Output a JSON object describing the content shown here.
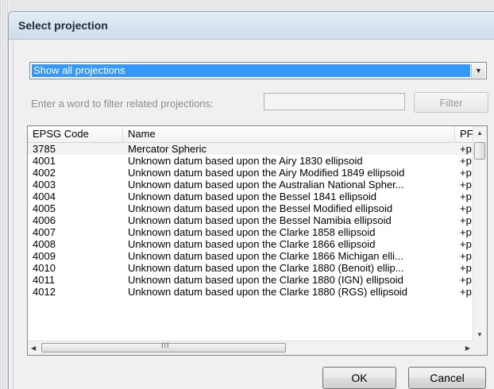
{
  "dialog": {
    "title": "Select projection"
  },
  "projection_filter": {
    "selected": "Show all projections",
    "label": "Enter a word to filter related projections:",
    "input_value": "",
    "filter_button": "Filter"
  },
  "table": {
    "columns": [
      "EPSG Code",
      "Name",
      "PF"
    ],
    "rows": [
      {
        "code": "3785",
        "name": "Mercator Spheric",
        "pf": "+p"
      },
      {
        "code": "4001",
        "name": "Unknown datum based upon the Airy 1830 ellipsoid",
        "pf": "+p"
      },
      {
        "code": "4002",
        "name": "Unknown datum based upon the Airy Modified 1849 ellipsoid",
        "pf": "+p"
      },
      {
        "code": "4003",
        "name": "Unknown datum based upon the Australian National Spher...",
        "pf": "+p"
      },
      {
        "code": "4004",
        "name": "Unknown datum based upon the Bessel 1841 ellipsoid",
        "pf": "+p"
      },
      {
        "code": "4005",
        "name": "Unknown datum based upon the Bessel Modified ellipsoid",
        "pf": "+p"
      },
      {
        "code": "4006",
        "name": "Unknown datum based upon the Bessel Namibia ellipsoid",
        "pf": "+p"
      },
      {
        "code": "4007",
        "name": "Unknown datum based upon the Clarke 1858 ellipsoid",
        "pf": "+p"
      },
      {
        "code": "4008",
        "name": "Unknown datum based upon the Clarke 1866 ellipsoid",
        "pf": "+p"
      },
      {
        "code": "4009",
        "name": "Unknown datum based upon the Clarke 1866 Michigan elli...",
        "pf": "+p"
      },
      {
        "code": "4010",
        "name": "Unknown datum based upon the Clarke 1880 (Benoit) ellip...",
        "pf": "+p"
      },
      {
        "code": "4011",
        "name": "Unknown datum based upon the Clarke 1880 (IGN) ellipsoid",
        "pf": "+p"
      },
      {
        "code": "4012",
        "name": "Unknown datum based upon the Clarke 1880 (RGS) ellipsoid",
        "pf": "+p"
      }
    ]
  },
  "scrollbar": {
    "grip": "III"
  },
  "buttons": {
    "ok": "OK",
    "cancel": "Cancel"
  },
  "icons": {
    "dropdown": "chevron-down-icon",
    "scroll_up": "arrow-up-icon",
    "scroll_down": "arrow-down-icon",
    "scroll_left": "arrow-left-icon",
    "scroll_right": "arrow-right-icon"
  },
  "colors": {
    "selection": "#3399ff",
    "title_bar": "#d5e1ee",
    "dialog_bg": "#f0f0f0"
  }
}
